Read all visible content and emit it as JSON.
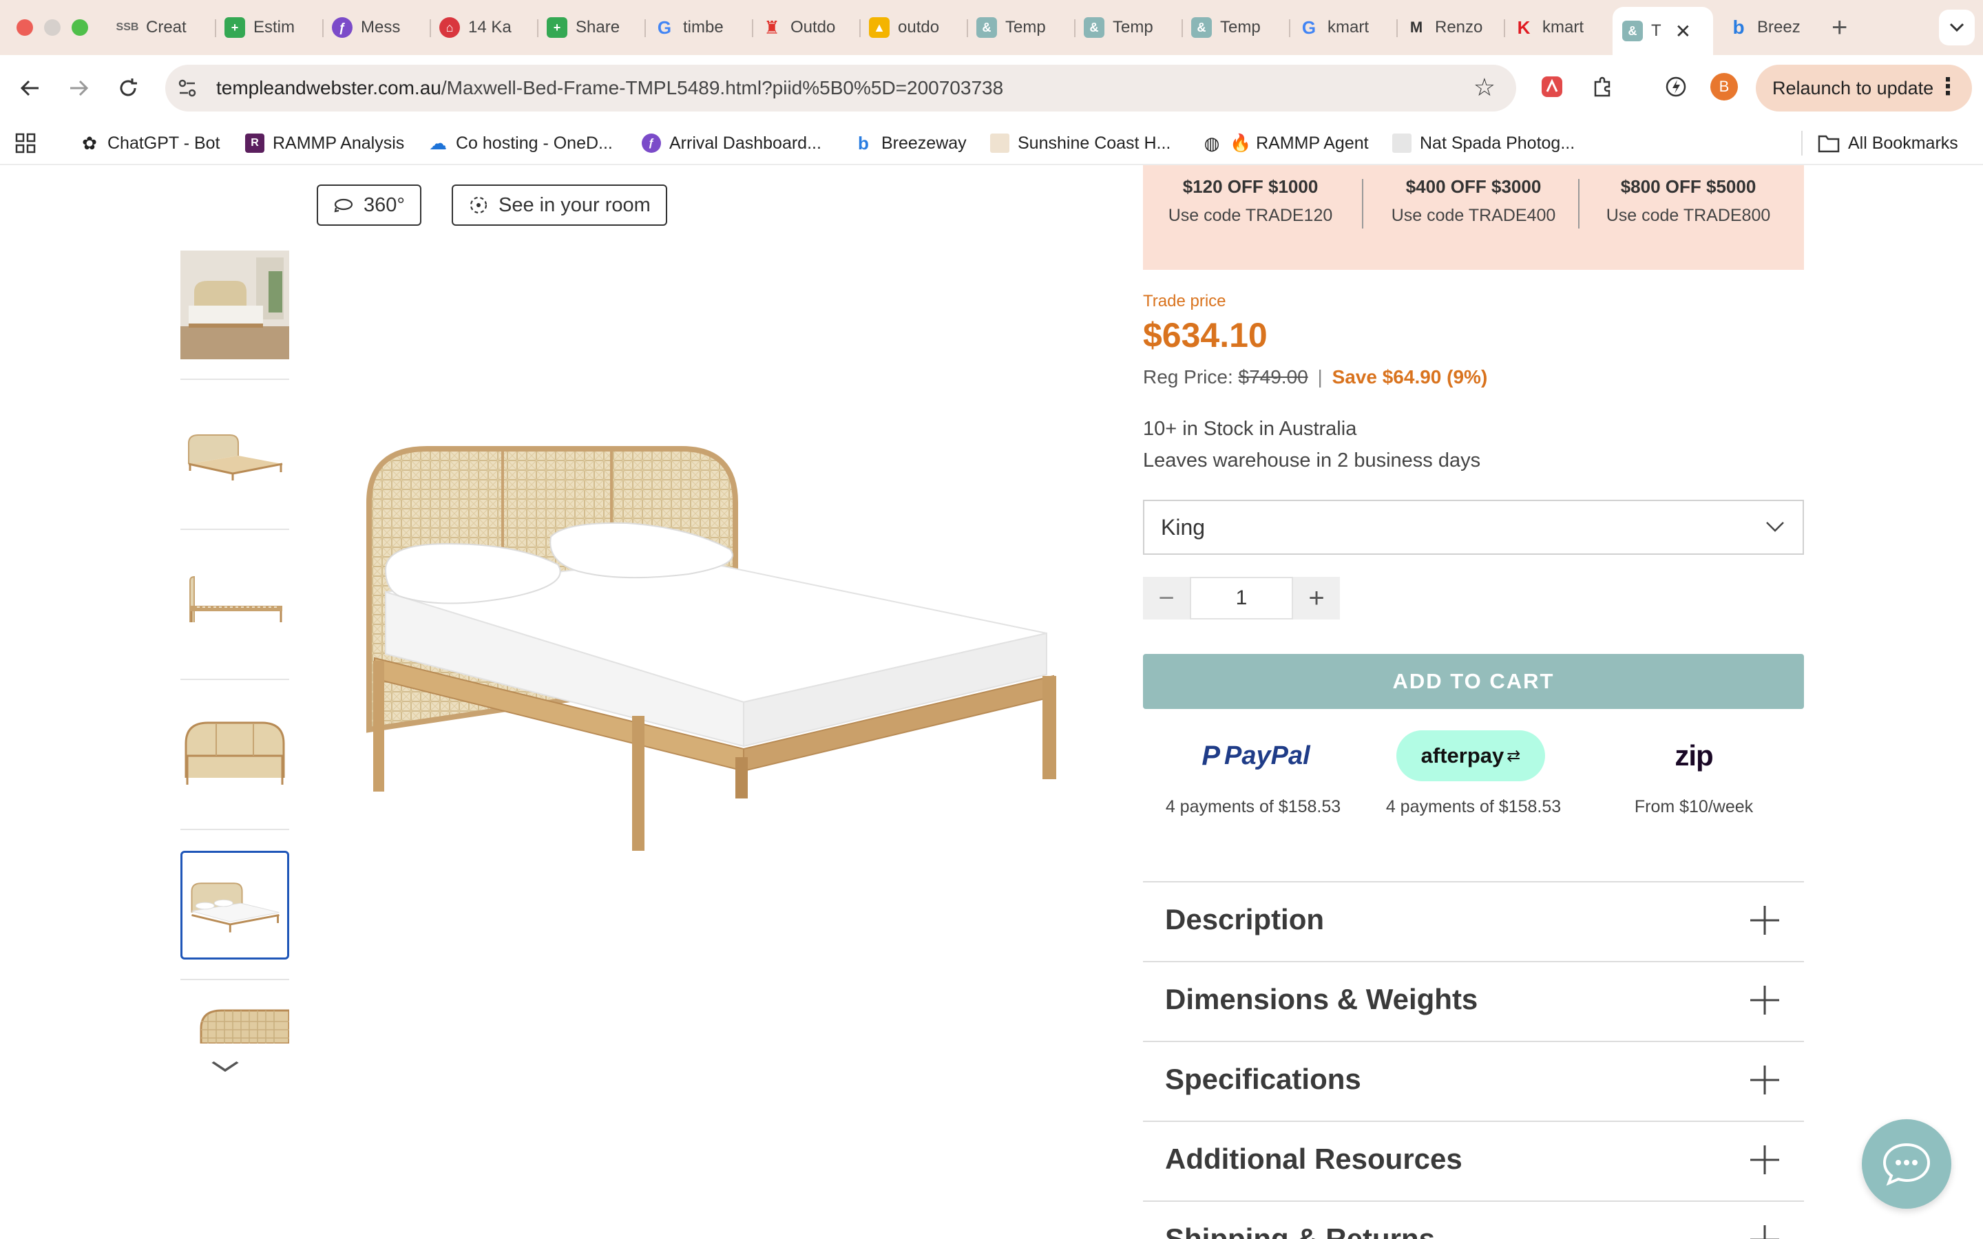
{
  "browser": {
    "tabs": [
      {
        "label": "Creat",
        "icon": "ssb-icon",
        "color": "#666666"
      },
      {
        "label": "Estim",
        "icon": "sheets-icon",
        "color": "#34a853"
      },
      {
        "label": "Mess",
        "icon": "messenger-icon",
        "color": "#7b4bc9"
      },
      {
        "label": "14 Ka",
        "icon": "home-icon",
        "color": "#d9363e"
      },
      {
        "label": "Share",
        "icon": "sheets-icon",
        "color": "#34a853"
      },
      {
        "label": "timbe",
        "icon": "google-icon",
        "color": "#4285f4"
      },
      {
        "label": "Outdo",
        "icon": "chair-icon",
        "color": "#e0322b"
      },
      {
        "label": "outdo",
        "icon": "bag-icon",
        "color": "#f4b400"
      },
      {
        "label": "Temp",
        "icon": "ampersand-icon",
        "color": "#8ab6b6"
      },
      {
        "label": "Temp",
        "icon": "ampersand-icon",
        "color": "#8ab6b6"
      },
      {
        "label": "Temp",
        "icon": "ampersand-icon",
        "color": "#8ab6b6"
      },
      {
        "label": "kmart",
        "icon": "google-icon",
        "color": "#4285f4"
      },
      {
        "label": "Renzo",
        "icon": "m-icon",
        "color": "#333333"
      },
      {
        "label": "kmart",
        "icon": "kmart-icon",
        "color": "#e01b22"
      },
      {
        "label": "T",
        "icon": "ampersand-icon",
        "color": "#8ab6b6",
        "active": true
      },
      {
        "label": "Breez",
        "icon": "breezeway-icon",
        "color": "#2a7de1"
      }
    ],
    "tab_close": "✕",
    "new_tab": "+",
    "address": {
      "domain": "templeandwebster.com.au",
      "path": "/Maxwell-Bed-Frame-TMPL5489.html?piid%5B0%5D=200703738"
    },
    "profile_initial": "B",
    "relaunch_label": "Relaunch to update",
    "bookmarks": [
      {
        "label": "ChatGPT - Bot",
        "icon": "openai-icon",
        "color": "#222222"
      },
      {
        "label": "RAMMP Analysis",
        "icon": "rammp-icon",
        "color": "#5b1f5e"
      },
      {
        "label": "Co hosting - OneD...",
        "icon": "onedrive-icon",
        "color": "#1e73d8"
      },
      {
        "label": "Arrival Dashboard...",
        "icon": "arrival-icon",
        "color": "#7b4bc9"
      },
      {
        "label": "Breezeway",
        "icon": "breezeway-icon",
        "color": "#2a7de1"
      },
      {
        "label": "Sunshine Coast H...",
        "icon": "sunshine-icon",
        "color": "#e8c9a0"
      },
      {
        "label": "🔥 RAMMP Agent",
        "icon": "globe-icon",
        "color": "#222222"
      },
      {
        "label": "Nat Spada Photog...",
        "icon": "photo-icon",
        "color": "#cccccc"
      }
    ],
    "all_bookmarks": "All Bookmarks"
  },
  "gallery": {
    "view_360": "360°",
    "see_in_room": "See in your room"
  },
  "promo": [
    {
      "headline": "$120 OFF $1000",
      "code": "Use code TRADE120"
    },
    {
      "headline": "$400 OFF $3000",
      "code": "Use code TRADE400"
    },
    {
      "headline": "$800 OFF $5000",
      "code": "Use code TRADE800"
    }
  ],
  "pricing": {
    "trade_label": "Trade price",
    "trade_price": "$634.10",
    "reg_label": "Reg Price:",
    "reg_price": "$749.00",
    "separator": "|",
    "save": "Save $64.90 (9%)"
  },
  "stock": {
    "line1": "10+ in Stock in Australia",
    "line2": "Leaves warehouse in 2 business days"
  },
  "size_select": {
    "value": "King"
  },
  "quantity": {
    "value": "1",
    "minus": "−",
    "plus": "+"
  },
  "add_to_cart": "ADD TO CART",
  "payments": [
    {
      "brand": "PayPal",
      "text": "4 payments of $158.53"
    },
    {
      "brand": "afterpay",
      "text": "4 payments of $158.53"
    },
    {
      "brand": "zip",
      "text": "From $10/week"
    }
  ],
  "accordion": [
    {
      "title": "Description"
    },
    {
      "title": "Dimensions & Weights"
    },
    {
      "title": "Specifications"
    },
    {
      "title": "Additional Resources"
    },
    {
      "title": "Shipping & Returns"
    }
  ]
}
